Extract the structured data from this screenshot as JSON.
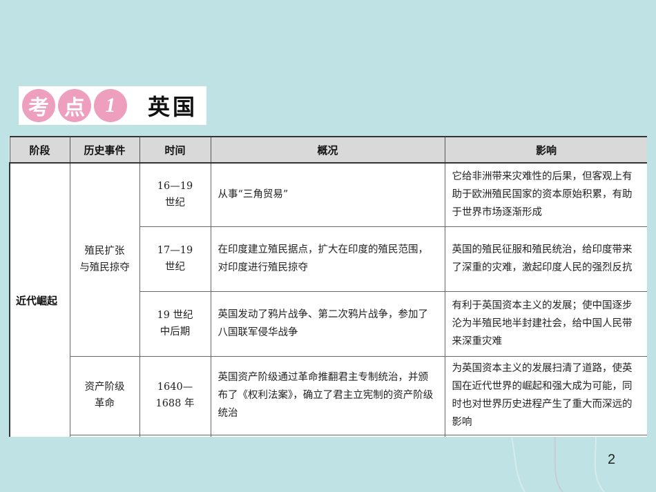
{
  "badge": {
    "bubbles": [
      "考",
      "点",
      "1"
    ],
    "title": "英国"
  },
  "table": {
    "headers": [
      "阶段",
      "历史事件",
      "时间",
      "概况",
      "影响"
    ],
    "stage": "近代崛起",
    "groups": [
      {
        "event": "殖民扩张\n与殖民掠夺",
        "rows": [
          {
            "time": "16—19\n世纪",
            "overview": "从事“三角贸易”",
            "impact": "它给非洲带来灾难性的后果，但客观上有助于欧洲殖民国家的资本原始积累，有助于世界市场逐渐形成"
          },
          {
            "time": "17—19\n世纪",
            "overview": "在印度建立殖民据点，扩大在印度的殖民范围，对印度进行殖民掠夺",
            "impact": "英国的殖民征服和殖民统治，给印度带来了深重的灾难，激起印度人民的强烈反抗"
          },
          {
            "time": "19 世纪\n中后期",
            "overview": "英国发动了鸦片战争、第二次鸦片战争，参加了八国联军侵华战争",
            "impact": "有利于英国资本主义的发展；使中国逐步沦为半殖民地半封建社会，给中国人民带来深重灾难"
          }
        ]
      },
      {
        "event": "资产阶级\n革命",
        "rows": [
          {
            "time": "1640—\n1688 年",
            "overview": "英国资产阶级通过革命推翻君主专制统治，并颁布了《权利法案》，确立了君主立宪制的资产阶级统治",
            "impact": "为英国资本主义的发展扫清了道路，使英国在近代世界的崛起和强大成为可能，同时也对世界历史进程产生了重大而深远的影响"
          }
        ]
      }
    ]
  },
  "page_number": "2",
  "colors": {
    "background": "#bfe2e4",
    "bubble": "#ee9fbe",
    "header_bg": "#d9d9d9"
  }
}
